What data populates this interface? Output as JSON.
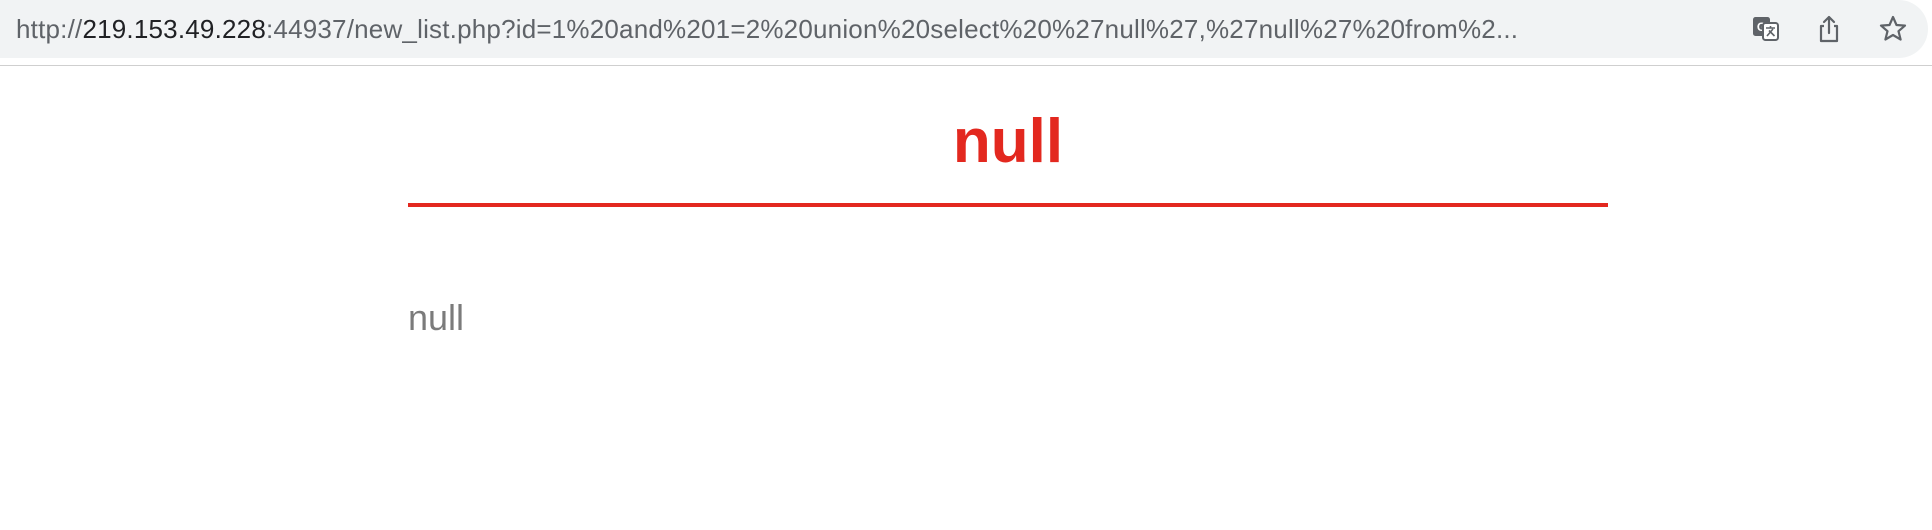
{
  "browser": {
    "url_scheme": "http://",
    "url_host": "219.153.49.228",
    "url_rest": ":44937/new_list.php?id=1%20and%201=2%20union%20select%20%27null%27,%27null%27%20from%2...",
    "icons": [
      "translate-icon",
      "share-icon",
      "bookmark-star-icon"
    ]
  },
  "page": {
    "title": "null",
    "content": "null"
  },
  "colors": {
    "accent": "#e3281f",
    "body_text": "#7b7b7b"
  }
}
